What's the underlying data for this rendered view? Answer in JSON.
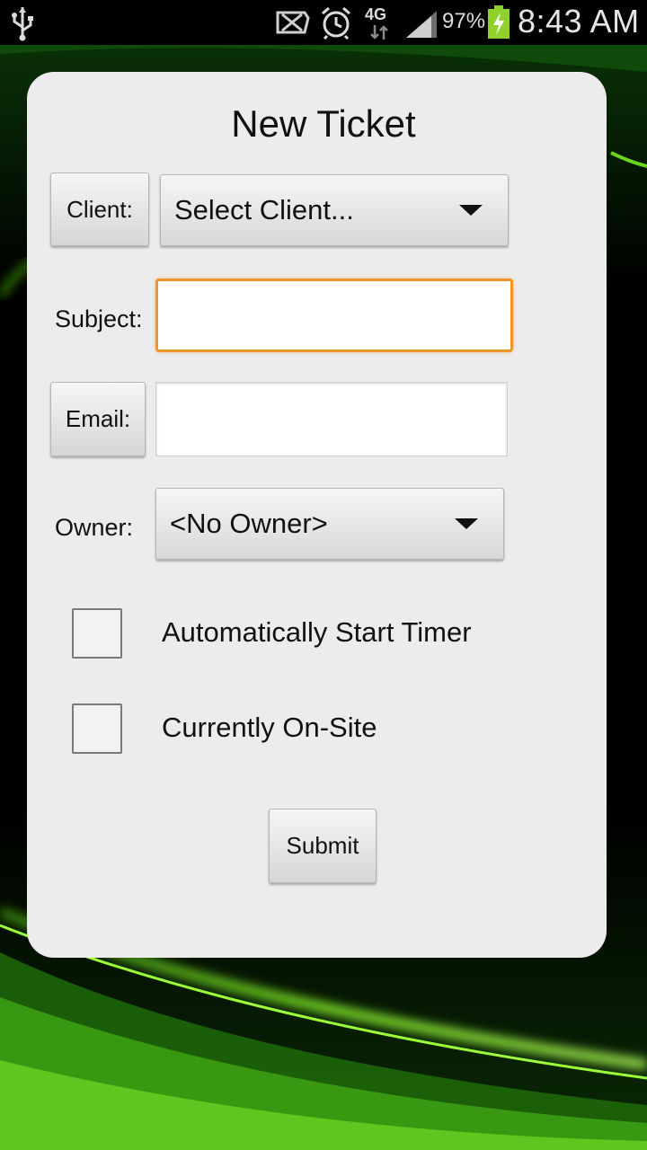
{
  "status_bar": {
    "battery_percent": "97%",
    "network": "4G",
    "time": "8:43 AM",
    "icons": [
      "usb-icon",
      "notification-icon",
      "alarm-icon",
      "network-4g-icon",
      "signal-icon",
      "battery-charging-icon"
    ]
  },
  "dialog": {
    "title": "New Ticket",
    "client": {
      "button_label": "Client:",
      "selected": "Select Client..."
    },
    "subject": {
      "label": "Subject:",
      "value": ""
    },
    "email": {
      "button_label": "Email:",
      "value": ""
    },
    "owner": {
      "label": "Owner:",
      "selected": "<No Owner>"
    },
    "options": [
      {
        "label": "Automatically Start Timer",
        "checked": false
      },
      {
        "label": "Currently On-Site",
        "checked": false
      }
    ],
    "submit_label": "Submit"
  },
  "colors": {
    "focus_accent": "#f0952a",
    "wallpaper_glow": "#7dff1a",
    "card_background": "#ececec"
  }
}
